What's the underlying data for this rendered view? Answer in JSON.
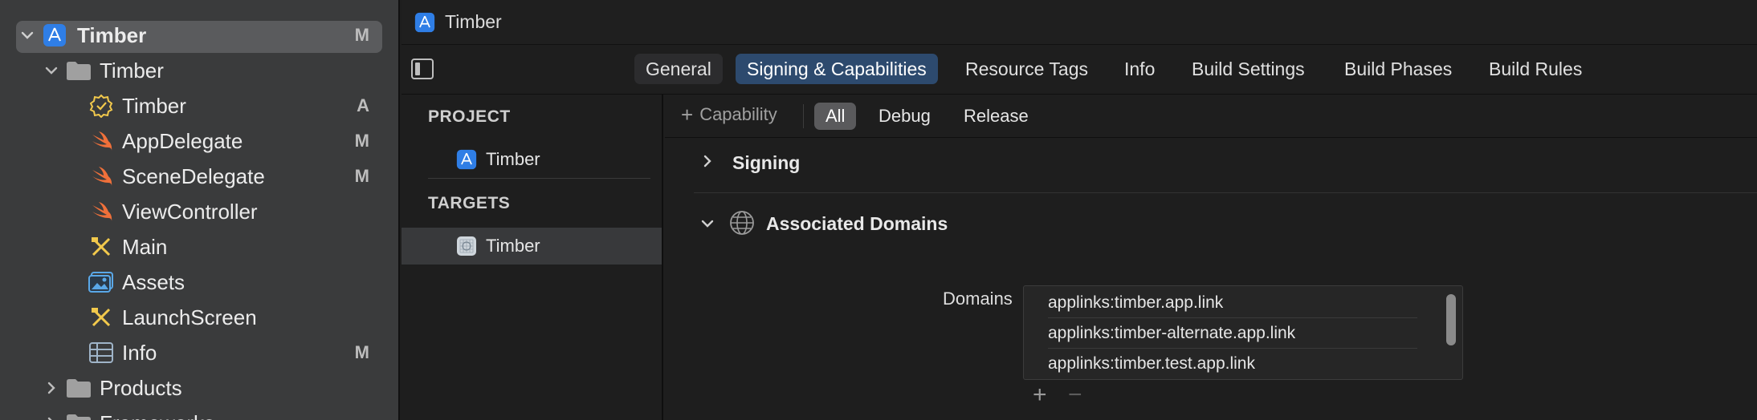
{
  "navigator": {
    "items": [
      {
        "label": "Timber",
        "badge": "M",
        "icon": "xcode-project-icon",
        "level": 0,
        "chevron": "down",
        "selected": true
      },
      {
        "label": "Timber",
        "badge": "",
        "icon": "folder-icon",
        "level": 1,
        "chevron": "down"
      },
      {
        "label": "Timber",
        "badge": "A",
        "icon": "entitlements-badge-icon",
        "level": 2,
        "chevron": ""
      },
      {
        "label": "AppDelegate",
        "badge": "M",
        "icon": "swift-file-icon",
        "level": 2,
        "chevron": ""
      },
      {
        "label": "SceneDelegate",
        "badge": "M",
        "icon": "swift-file-icon",
        "level": 2,
        "chevron": ""
      },
      {
        "label": "ViewController",
        "badge": "",
        "icon": "swift-file-icon",
        "level": 2,
        "chevron": ""
      },
      {
        "label": "Main",
        "badge": "",
        "icon": "storyboard-icon",
        "level": 2,
        "chevron": ""
      },
      {
        "label": "Assets",
        "badge": "",
        "icon": "asset-catalog-icon",
        "level": 2,
        "chevron": ""
      },
      {
        "label": "LaunchScreen",
        "badge": "",
        "icon": "storyboard-icon",
        "level": 2,
        "chevron": ""
      },
      {
        "label": "Info",
        "badge": "M",
        "icon": "plist-table-icon",
        "level": 2,
        "chevron": ""
      },
      {
        "label": "Products",
        "badge": "",
        "icon": "folder-icon",
        "level": 1,
        "chevron": "right"
      },
      {
        "label": "Frameworks",
        "badge": "",
        "icon": "folder-icon",
        "level": 1,
        "chevron": "right"
      }
    ]
  },
  "jumpbar": {
    "title": "Timber"
  },
  "tabs": {
    "items": [
      "General",
      "Signing & Capabilities",
      "Resource Tags",
      "Info",
      "Build Settings",
      "Build Phases",
      "Build Rules"
    ],
    "active": "Signing & Capabilities"
  },
  "targets_list": {
    "project_header": "PROJECT",
    "project_item": "Timber",
    "targets_header": "TARGETS",
    "target_item": "Timber"
  },
  "capabilities": {
    "add_label": "Capability",
    "filters": [
      "All",
      "Debug",
      "Release"
    ],
    "active_filter": "All",
    "signing_title": "Signing",
    "assoc_title": "Associated Domains",
    "domains_label": "Domains",
    "domains": [
      "applinks:timber.app.link",
      "applinks:timber-alternate.app.link",
      "applinks:timber.test.app.link"
    ],
    "add_symbol": "+",
    "remove_symbol": "−"
  },
  "colors": {
    "accent_tab": "#2d4a6e",
    "swift_orange": "#f0703a",
    "storyboard_yellow": "#f2c94c",
    "folder_gray": "#9a9a9a"
  }
}
